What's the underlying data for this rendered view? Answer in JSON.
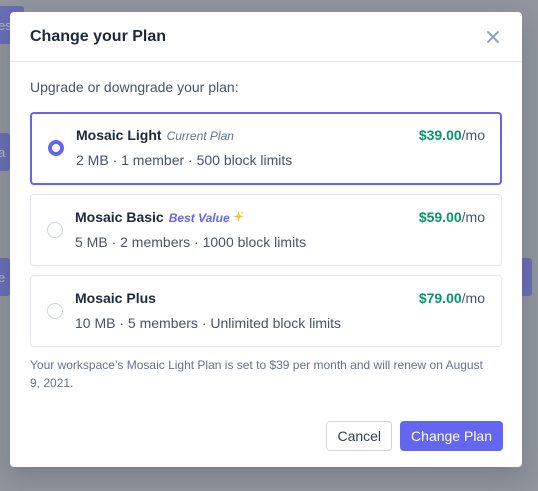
{
  "background": {
    "fragments": [
      "es",
      "a",
      "e"
    ]
  },
  "modal": {
    "title": "Change your Plan",
    "close_icon": "close-icon",
    "prompt": "Upgrade or downgrade your plan:",
    "plans": [
      {
        "name": "Mosaic Light",
        "tag": "Current Plan",
        "description": "2 MB · 1 member · 500 block limits",
        "price": "$39.00",
        "period": "/mo",
        "selected": true
      },
      {
        "name": "Mosaic Basic",
        "tag": "Best Value",
        "tag_icon": "sparkle-icon",
        "description": "5 MB · 2 members · 1000 block limits",
        "price": "$59.00",
        "period": "/mo",
        "selected": false
      },
      {
        "name": "Mosaic Plus",
        "tag": "",
        "description": "10 MB · 5 members · Unlimited block limits",
        "price": "$79.00",
        "period": "/mo",
        "selected": false
      }
    ],
    "notice": "Your workspace’s Mosaic Light Plan is set to $39 per month and will renew on August 9, 2021.",
    "cancel_label": "Cancel",
    "confirm_label": "Change Plan"
  },
  "colors": {
    "accent": "#6366f1",
    "price": "#059669",
    "overlay": "#b3b6bd"
  }
}
